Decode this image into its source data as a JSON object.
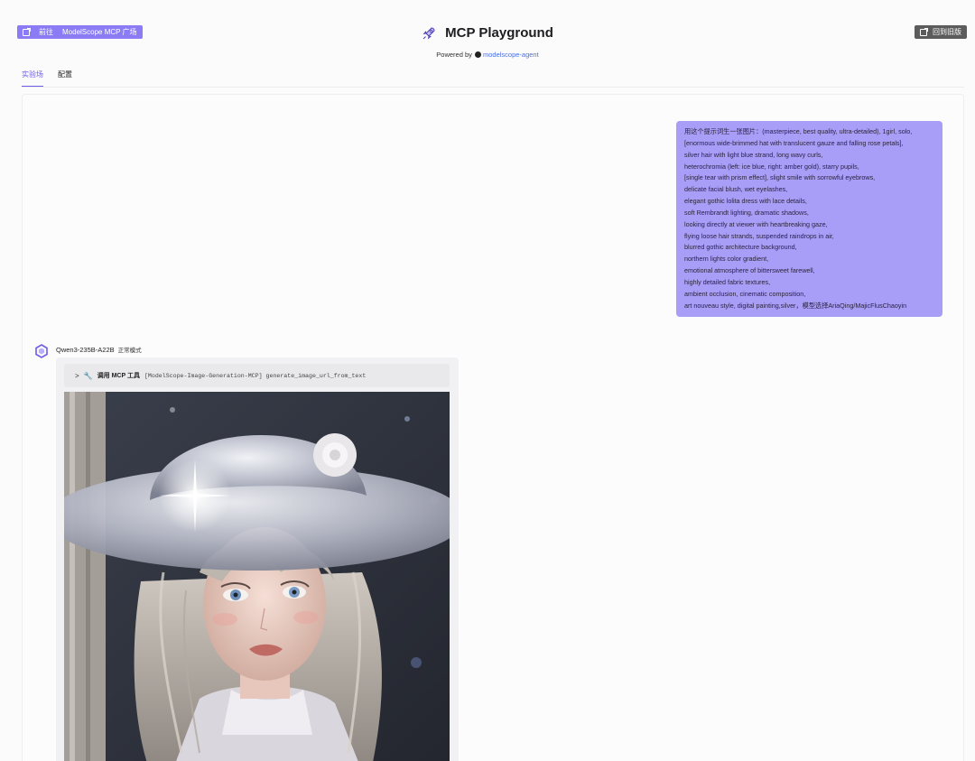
{
  "header": {
    "goto_label": "前往",
    "goto_target": "ModelScope MCP 广场",
    "title": "MCP Playground",
    "powered_prefix": "Powered by",
    "powered_link": "modelscope-agent",
    "old_version_label": "回到旧版"
  },
  "tabs": [
    {
      "label": "实验场",
      "active": true
    },
    {
      "label": "配置",
      "active": false
    }
  ],
  "user_message": {
    "lines": [
      "用这个提示词生一张图片：(masterpiece, best quality, ultra-detailed), 1girl, solo,",
      "[enormous wide-brimmed hat with translucent gauze and falling rose petals],",
      "silver hair with light blue strand, long wavy curls,",
      "heterochromia (left: ice blue, right: amber gold), starry pupils,",
      "[single tear with prism effect], slight smile with sorrowful eyebrows,",
      "delicate facial blush, wet eyelashes,",
      "elegant gothic lolita dress with lace details,",
      "soft Rembrandt lighting, dramatic shadows,",
      "looking directly at viewer with heartbreaking gaze,",
      "flying loose hair strands, suspended raindrops in air,",
      "blurred gothic architecture background,",
      "northern lights color gradient,",
      "emotional atmosphere of bittersweet farewell,",
      "highly detailed fabric textures,",
      "ambient occlusion, cinematic composition,",
      "art nouveau style, digital painting,silver，模型选择AriaQing/MajicFlusChaoyin"
    ]
  },
  "assistant": {
    "model": "Qwen3-235B-A22B",
    "mode": "正常模式",
    "tool_call": {
      "label": "调用 MCP 工具",
      "code": "[ModelScope-Image-Generation-MCP] generate_image_url_from_text"
    }
  },
  "colors": {
    "accent": "#8b7cf6",
    "user_bubble": "#a99ef7",
    "old_button": "#5c5c5c"
  },
  "icons": {
    "logo": "rocket-icon",
    "avatar": "qwen-logo-icon",
    "tool": "wrench-icon",
    "expand": "chevron-right-icon",
    "github": "github-icon",
    "external": "external-link-icon"
  }
}
